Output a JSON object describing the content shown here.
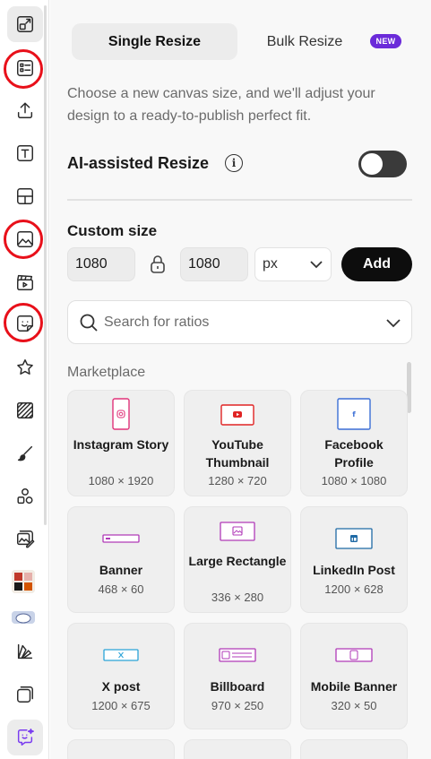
{
  "sidebar": {
    "items": [
      {
        "name": "resize-icon",
        "active": true
      },
      {
        "name": "templates-icon"
      },
      {
        "name": "upload-icon"
      },
      {
        "name": "text-icon"
      },
      {
        "name": "layout-icon"
      },
      {
        "name": "image-icon"
      },
      {
        "name": "video-icon"
      },
      {
        "name": "sticker-icon"
      },
      {
        "name": "star-icon"
      },
      {
        "name": "pattern-icon"
      },
      {
        "name": "brush-icon"
      },
      {
        "name": "elements-icon"
      },
      {
        "name": "photo-edit-icon"
      },
      {
        "name": "apps-thumbnail"
      },
      {
        "name": "recent-thumbnail"
      },
      {
        "name": "brand-kit-icon"
      },
      {
        "name": "pages-icon"
      },
      {
        "name": "ai-chat-icon"
      }
    ]
  },
  "tabs": {
    "single": "Single Resize",
    "bulk": "Bulk Resize",
    "new_badge": "NEW"
  },
  "description": "Choose a new canvas size, and we'll adjust your design to a ready-to-publish perfect fit.",
  "ai_resize": {
    "label": "AI-assisted Resize",
    "info": "i",
    "enabled": false
  },
  "custom_size": {
    "label": "Custom size",
    "width": "1080",
    "height": "1080",
    "unit": "px",
    "add_label": "Add"
  },
  "search": {
    "placeholder": "Search for ratios"
  },
  "marketplace": {
    "label": "Marketplace",
    "presets": [
      {
        "name": "Instagram Story",
        "dims": "1080 × 1920",
        "icon": "instagram-icon",
        "color": "#e0337a"
      },
      {
        "name": "YouTube Thumbnail",
        "dims": "1280 × 720",
        "icon": "youtube-icon",
        "color": "#e02424"
      },
      {
        "name": "Facebook Profile",
        "dims": "1080 × 1080",
        "icon": "facebook-icon",
        "color": "#3b6fd6"
      },
      {
        "name": "Banner",
        "dims": "468 × 60",
        "icon": "banner-icon",
        "color": "#b03ab8"
      },
      {
        "name": "Large Rectangle",
        "dims": "336 × 280",
        "icon": "large-rectangle-icon",
        "color": "#b03ab8"
      },
      {
        "name": "LinkedIn Post",
        "dims": "1200 × 628",
        "icon": "linkedin-icon",
        "color": "#1f6aa5"
      },
      {
        "name": "X post",
        "dims": "1200 × 675",
        "icon": "x-icon",
        "color": "#2aa3d8"
      },
      {
        "name": "Billboard",
        "dims": "970 × 250",
        "icon": "billboard-icon",
        "color": "#b03ab8"
      },
      {
        "name": "Mobile Banner",
        "dims": "320 × 50",
        "icon": "mobile-banner-icon",
        "color": "#b03ab8"
      }
    ]
  }
}
